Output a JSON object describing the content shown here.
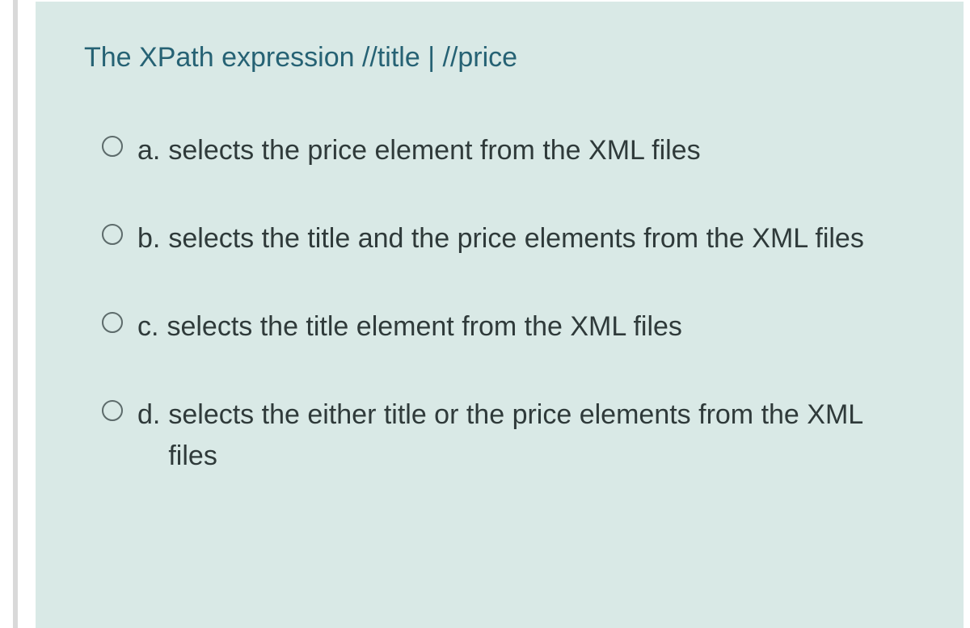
{
  "question": "The XPath expression //title | //price",
  "options": [
    {
      "letter": "a.",
      "text": "selects the price element from the XML files"
    },
    {
      "letter": "b.",
      "text": "selects the title and the price elements from the XML files"
    },
    {
      "letter": "c.",
      "text": "selects the title element from the XML files"
    },
    {
      "letter": "d.",
      "text": "selects the either title or  the price elements from the XML files"
    }
  ]
}
